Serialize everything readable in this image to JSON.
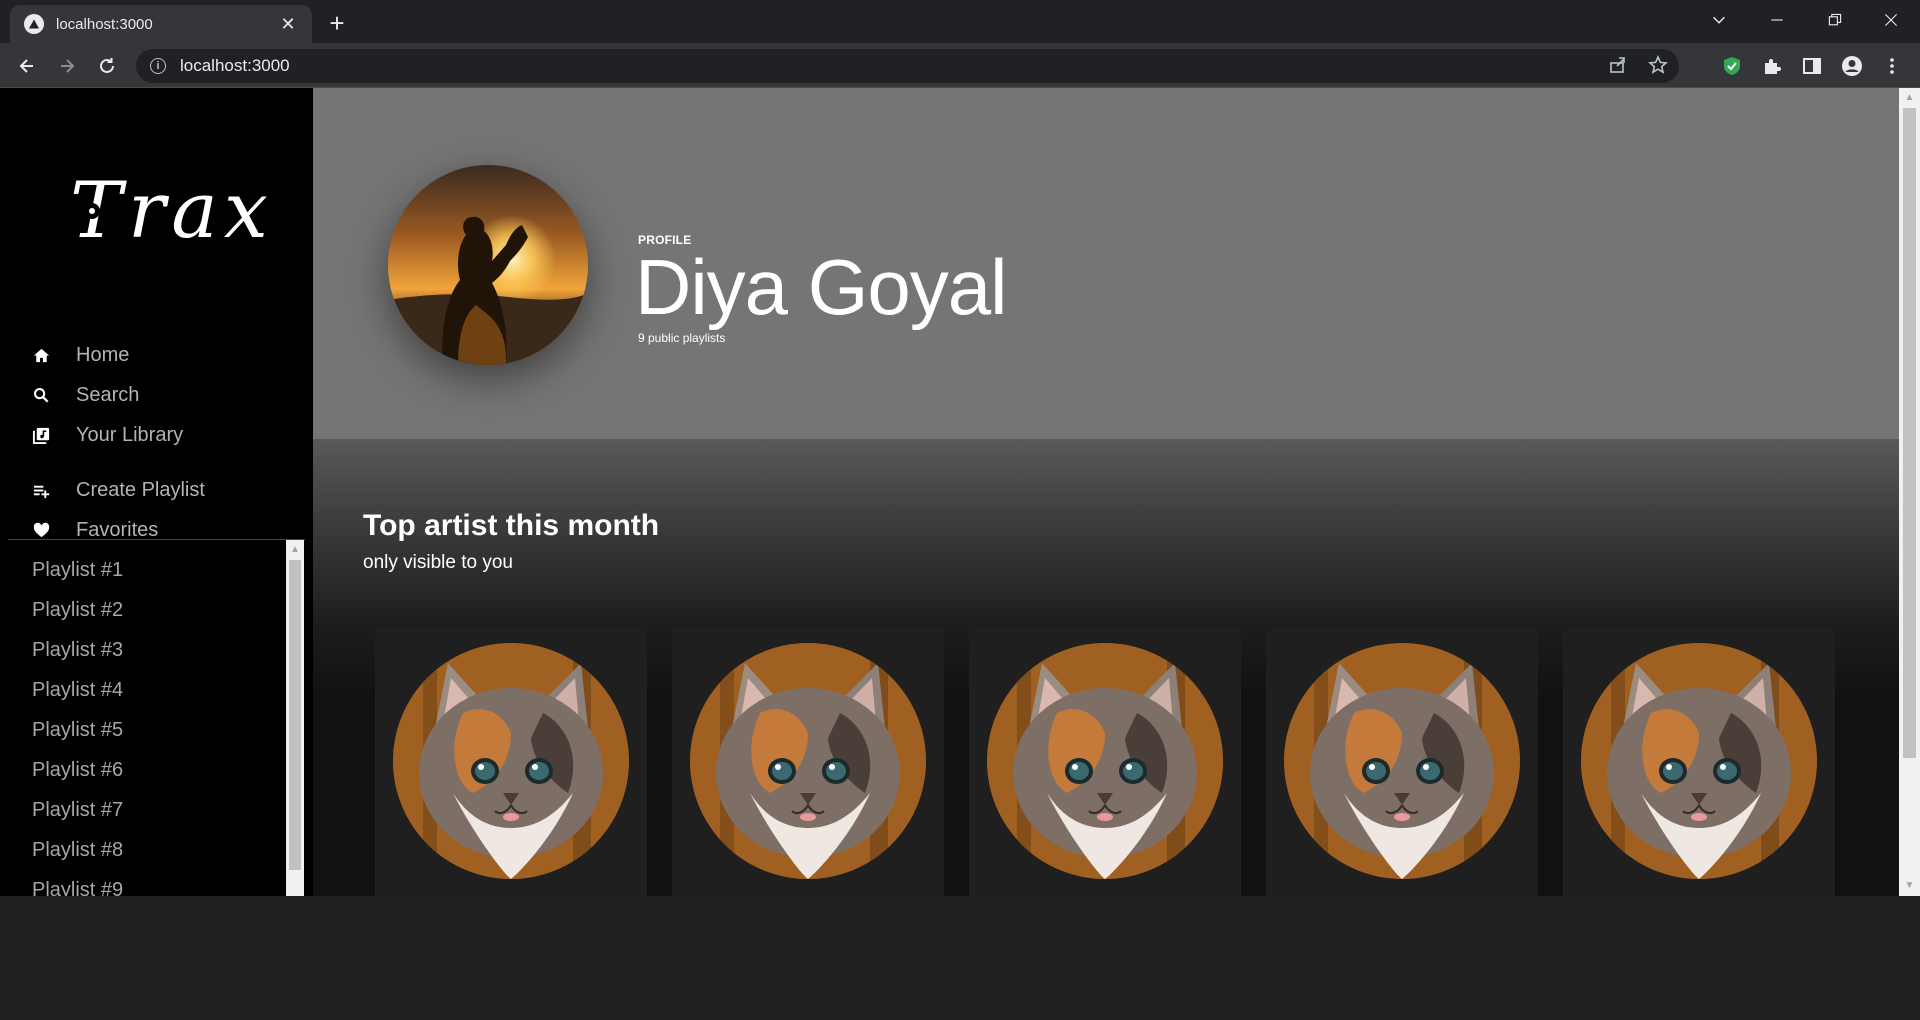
{
  "browser": {
    "tab_title": "localhost:3000",
    "url": "localhost:3000",
    "new_tab_glyph": "+",
    "close_glyph": "✕"
  },
  "sidebar": {
    "logo_text": "Trax",
    "menu": [
      {
        "label": "Home",
        "icon": "home-icon"
      },
      {
        "label": "Search",
        "icon": "search-icon"
      },
      {
        "label": "Your Library",
        "icon": "library-icon"
      },
      {
        "label": "Create Playlist",
        "icon": "playlist-add-icon"
      },
      {
        "label": "Favorites",
        "icon": "heart-icon"
      }
    ],
    "playlists": [
      "Playlist #1",
      "Playlist #2",
      "Playlist #3",
      "Playlist #4",
      "Playlist #5",
      "Playlist #6",
      "Playlist #7",
      "Playlist #8",
      "Playlist #9"
    ]
  },
  "profile": {
    "label": "PROFILE",
    "name": "Diya Goyal",
    "subtitle": "9 public playlists",
    "header_color": "#757575"
  },
  "section": {
    "title": "Top artist this month",
    "subtitle": "only visible to you",
    "artist_count": 5
  }
}
